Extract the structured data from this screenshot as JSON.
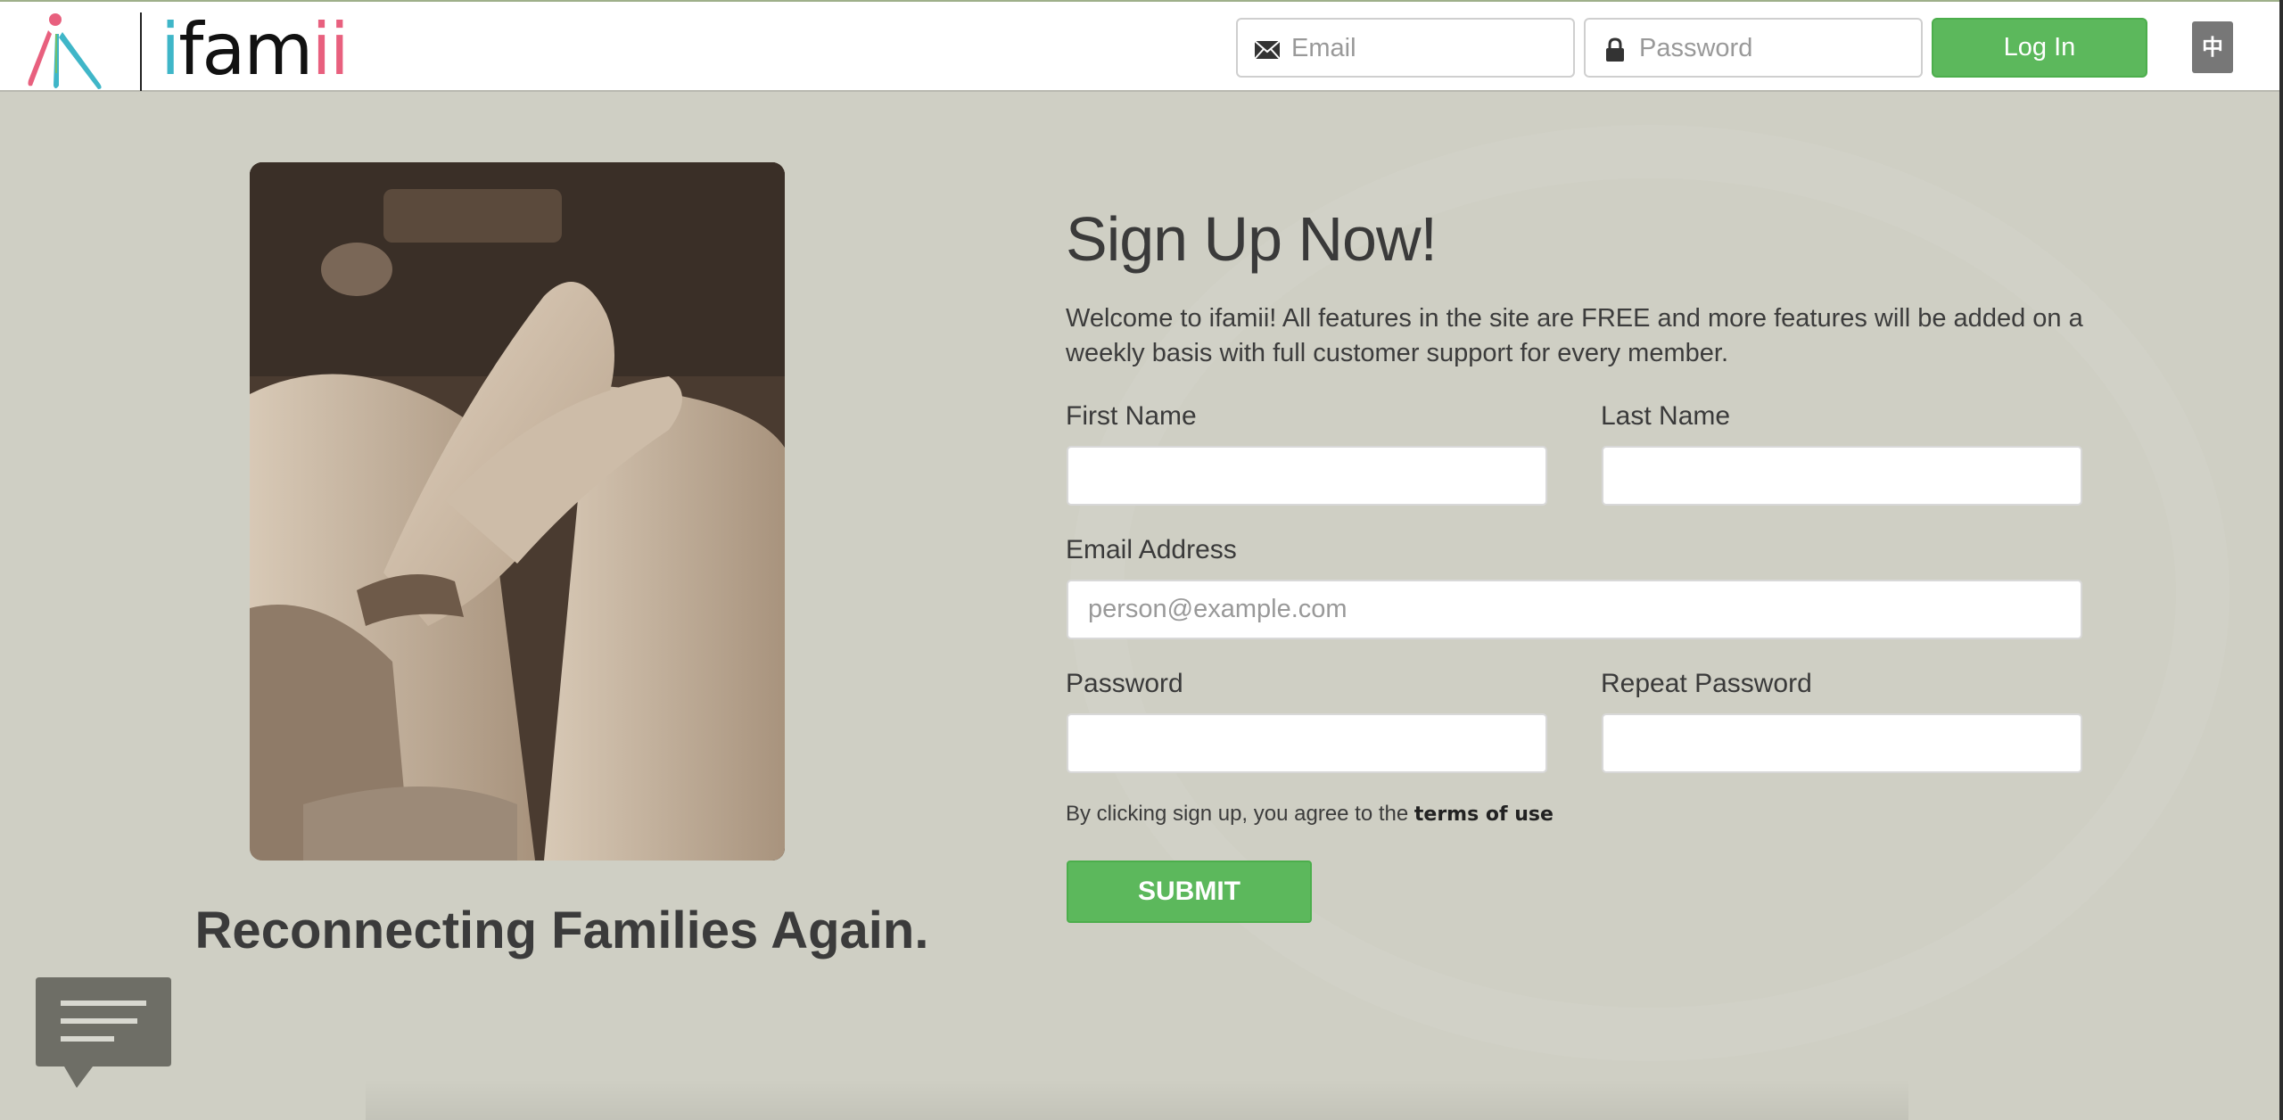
{
  "header": {
    "logo_text_parts": [
      "i",
      "fam",
      "i",
      "i"
    ],
    "email_placeholder": "Email",
    "password_placeholder": "Password",
    "login_label": "Log In",
    "language_label": "中",
    "icons": {
      "email": "envelope-icon",
      "password": "lock-icon"
    }
  },
  "hero": {
    "tagline": "Reconnecting Families Again.",
    "photo": "sepia-holding-hands-photo"
  },
  "signup": {
    "title": "Sign Up Now!",
    "intro": "Welcome to ifamii! All features in the site are FREE and more features will be added on a weekly basis with full customer support for every member.",
    "first_name_label": "First Name",
    "last_name_label": "Last Name",
    "email_label": "Email Address",
    "email_placeholder": "person@example.com",
    "password_label": "Password",
    "repeat_password_label": "Repeat Password",
    "terms_prefix": "By clicking sign up, you agree to the ",
    "terms_link": "terms of use",
    "submit_label": "SUBMIT"
  },
  "colors": {
    "accent_green": "#5cb85c",
    "background": "#cfcfc4",
    "logo_teal": "#3fb6c8",
    "logo_pink": "#e8607e"
  },
  "chat_widget": {
    "icon": "chat-bubble-icon"
  }
}
